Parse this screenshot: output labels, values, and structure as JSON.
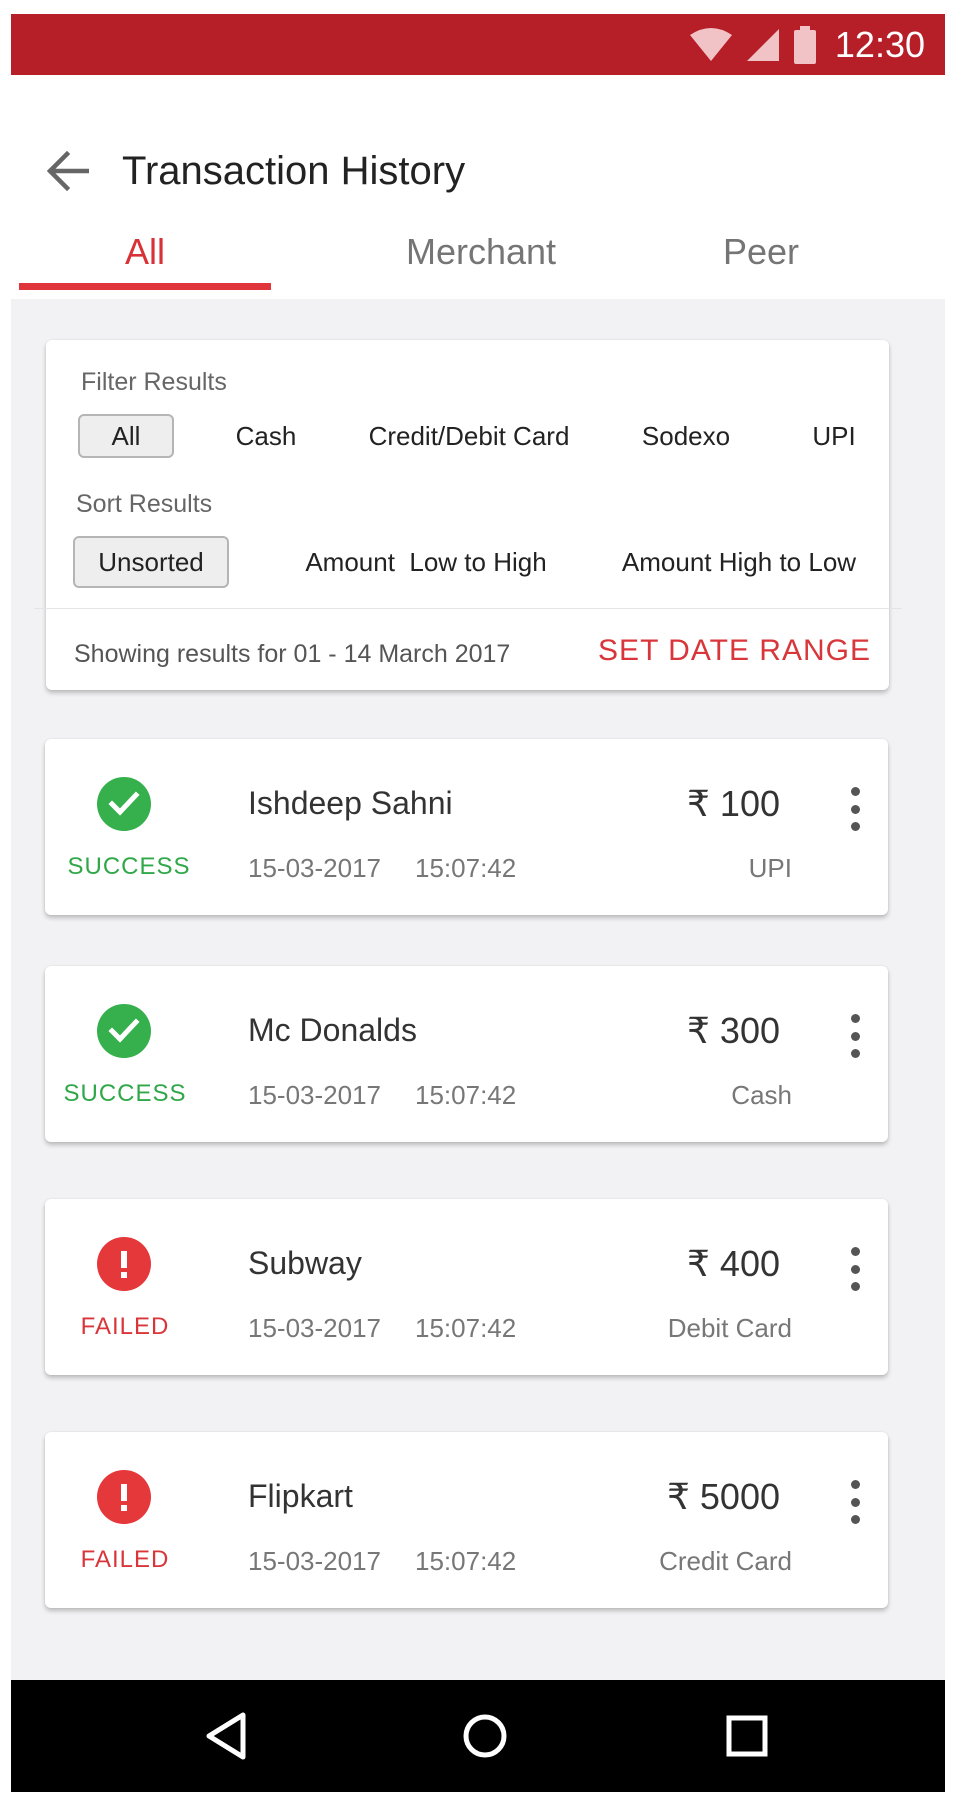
{
  "status_bar": {
    "time": "12:30",
    "icons": [
      "wifi-icon",
      "signal-icon",
      "battery-icon"
    ]
  },
  "header": {
    "title": "Transaction History",
    "back_icon": "arrow-left-icon"
  },
  "tabs": [
    {
      "label": "All",
      "active": true
    },
    {
      "label": "Merchant",
      "active": false
    },
    {
      "label": "Peer",
      "active": false
    }
  ],
  "filter": {
    "filter_label": "Filter Results",
    "filter_options": [
      "All",
      "Cash",
      "Credit/Debit Card",
      "Sodexo",
      "UPI"
    ],
    "filter_selected": "All",
    "sort_label": "Sort Results",
    "sort_options": [
      "Unsorted",
      "Amount  Low to High",
      "Amount High to Low"
    ],
    "sort_selected": "Unsorted",
    "range_text": "Showing results for 01 - 14 March 2017",
    "set_range_label": "SET DATE RANGE"
  },
  "transactions": [
    {
      "status": "SUCCESS",
      "name": "Ishdeep Sahni",
      "date": "15-03-2017",
      "time": "15:07:42",
      "amount": "₹ 100",
      "method": "UPI"
    },
    {
      "status": "SUCCESS",
      "name": "Mc Donalds",
      "date": "15-03-2017",
      "time": "15:07:42",
      "amount": "₹ 300",
      "method": "Cash"
    },
    {
      "status": "FAILED",
      "name": "Subway",
      "date": "15-03-2017",
      "time": "15:07:42",
      "amount": "₹ 400",
      "method": "Debit Card"
    },
    {
      "status": "FAILED",
      "name": "Flipkart",
      "date": "15-03-2017",
      "time": "15:07:42",
      "amount": "₹ 5000",
      "method": "Credit Card"
    }
  ],
  "colors": {
    "status_bar": "#b71f28",
    "accent": "#e0353a",
    "success": "#35b04c",
    "failed": "#e5383b"
  },
  "nav_bar": [
    "nav-back-icon",
    "nav-home-icon",
    "nav-recents-icon"
  ]
}
